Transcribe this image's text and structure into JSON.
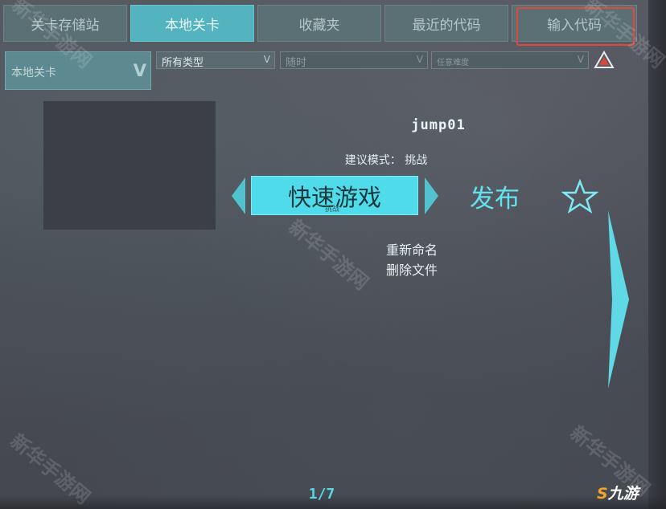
{
  "tabs": [
    {
      "label": "关卡存储站",
      "active": false
    },
    {
      "label": "本地关卡",
      "active": true
    },
    {
      "label": "收藏夹",
      "active": false
    },
    {
      "label": "最近的代码",
      "active": false
    },
    {
      "label": "输入代码",
      "active": false,
      "highlighted": true
    }
  ],
  "filters": {
    "source": "本地关卡",
    "type": "所有类型",
    "time": "随时",
    "difficulty": "任意难度",
    "chevron": "V"
  },
  "level": {
    "name": "jump01",
    "suggested_mode": "建议模式：  挑战",
    "play_label": "快速游戏",
    "play_sublabel": "挑战",
    "publish_label": "发布",
    "rename_label": "重新命名",
    "delete_label": "删除文件"
  },
  "pager": {
    "text": "1/7"
  },
  "watermark": {
    "text": "新华手游网",
    "brand": "九游"
  },
  "colors": {
    "accent": "#4fdbe9",
    "highlight": "#e0483c",
    "tab_active": "#53b3be"
  },
  "icons": {
    "warning": "warning-icon",
    "favorite": "star-outline-icon",
    "next": "next-page-arrow-icon"
  }
}
